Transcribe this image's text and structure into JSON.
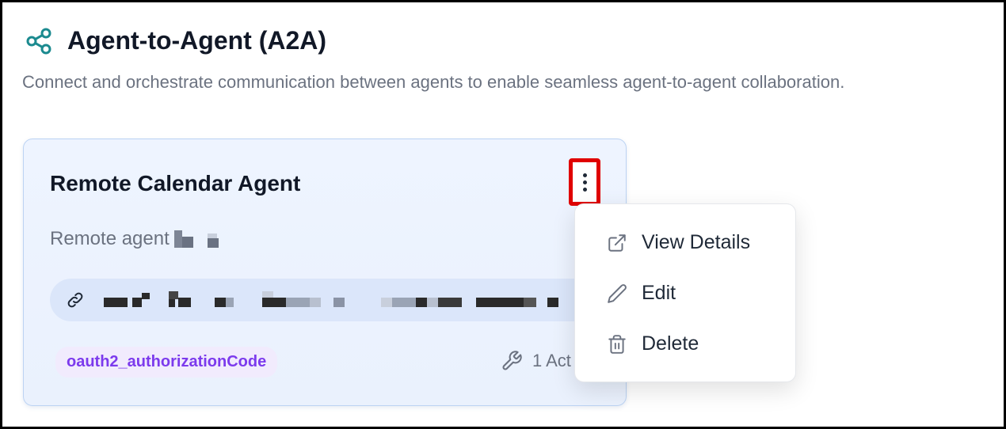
{
  "header": {
    "title": "Agent-to-Agent (A2A)",
    "subtitle": "Connect and orchestrate communication between agents to enable seamless agent-to-agent collaboration.",
    "icon": "share-nodes-icon",
    "accent_color": "#1b8a8f"
  },
  "card": {
    "title": "Remote Calendar Agent",
    "description": "Remote agent",
    "auth_type": "oauth2_authorizationCode",
    "actions_label": "1 Act",
    "url_icon": "link-icon",
    "actions_icon": "wrench-icon",
    "menu_icon": "kebab-menu-icon"
  },
  "menu": {
    "items": [
      {
        "label": "View Details",
        "icon": "external-link-icon"
      },
      {
        "label": "Edit",
        "icon": "pencil-icon"
      },
      {
        "label": "Delete",
        "icon": "trash-icon"
      }
    ]
  },
  "colors": {
    "highlight_border": "#e00000",
    "badge_text": "#7c3aed",
    "card_border": "#bcd3f3"
  }
}
